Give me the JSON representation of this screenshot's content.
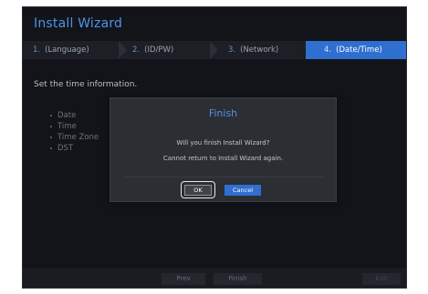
{
  "wizard": {
    "title": "Install Wizard",
    "steps": [
      {
        "num": "1.",
        "label": "(Language)"
      },
      {
        "num": "2.",
        "label": "(ID/PW)"
      },
      {
        "num": "3.",
        "label": "(Network)"
      },
      {
        "num": "4.",
        "label": "(Date/Time)"
      }
    ],
    "active_step": 4,
    "section_title": "Set the time information.",
    "fields": [
      "Date",
      "Time",
      "Time Zone",
      "DST"
    ]
  },
  "dialog": {
    "title": "Finish",
    "message_1": "Will you finish Install Wizard?",
    "message_2": "Cannot return to Install Wizard again.",
    "ok_label": "OK",
    "cancel_label": "Cancel"
  },
  "footer": {
    "prev_label": "Prev",
    "finish_label": "Finish",
    "exit_label": "Exit"
  },
  "colors": {
    "accent": "#2f6fd0",
    "title_blue": "#4f93e6",
    "background": "#121419"
  }
}
